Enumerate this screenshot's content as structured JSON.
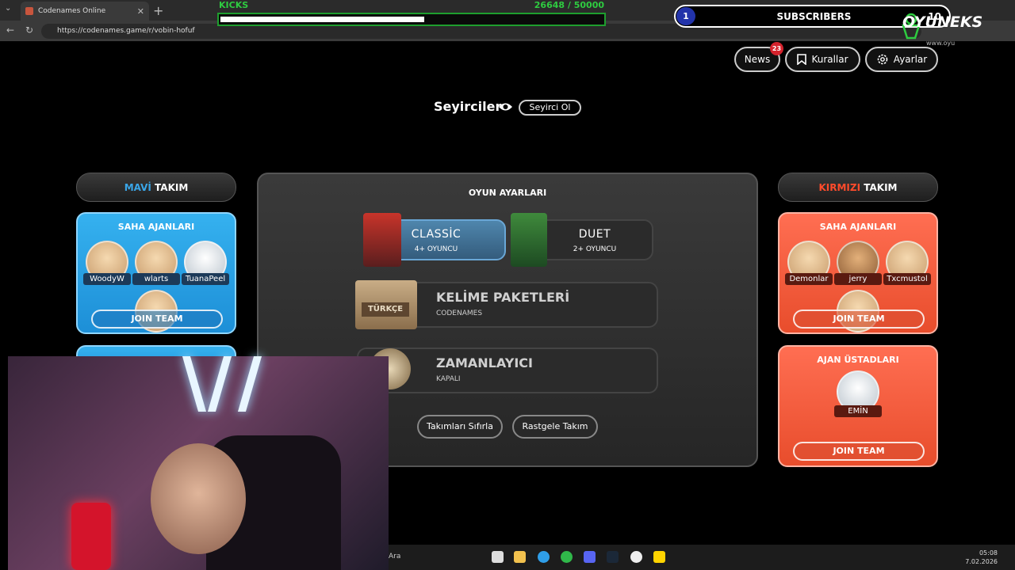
{
  "browser": {
    "tab_title": "Codenames Online",
    "tab_close": "✕",
    "new_tab": "+",
    "url": "https://codenames.game/r/vobin-hofuf"
  },
  "overlay": {
    "kicks_label": "KICKS",
    "kicks_value": "26648 / 50000",
    "kicks_progress": 0.533,
    "subscribers_rank": "1",
    "subscribers_label": "SUBSCRIBERS",
    "subscribers_goal": "10",
    "brand": "OYUNEKS",
    "brand_sub": "www.oyu"
  },
  "topnav": {
    "news_label": "News",
    "news_badge": "23",
    "rules_label": "Kurallar",
    "settings_label": "Ayarlar"
  },
  "spectators": {
    "label": "Seyirciler",
    "button": "Seyirci Ol"
  },
  "blue_team": {
    "header_word": "MAVİ",
    "header_rest": " TAKIM",
    "operatives_title": "SAHA AJANLARI",
    "players": [
      "WoodyW",
      "wlarts",
      "TuanaPeel"
    ],
    "join_label": "JOIN TEAM"
  },
  "red_team": {
    "header_word": "KIRMIZI",
    "header_rest": " TAKIM",
    "operatives_title": "SAHA AJANLARI",
    "players": [
      "Demonlar",
      "jerry",
      "Txcmustol"
    ],
    "join_label": "JOIN TEAM",
    "spymaster_title": "AJAN ÜSTADLARI",
    "spymaster": "EMİN",
    "spymaster_join": "JOIN TEAM"
  },
  "game_settings": {
    "title": "OYUN AYARLARI",
    "classic_name": "CLASSİC",
    "classic_sub": "4+ OYUNCU",
    "duet_name": "DUET",
    "duet_sub": "2+ OYUNCU",
    "word_pack_title": "KELİME PAKETLERİ",
    "word_pack_sub": "CODENAMES",
    "word_pack_box": "TÜRKÇE",
    "timer_title": "ZAMANLAYICI",
    "timer_sub": "KAPALI",
    "reset_teams": "Takımları Sıfırla",
    "random_teams": "Rastgele Takım"
  },
  "taskbar": {
    "search_text": "Ara",
    "time": "05:08",
    "date": "7.02.2026"
  },
  "colors": {
    "blue": "#2ea7ec",
    "red": "#f2583a",
    "kicks_green": "#2ecc40"
  }
}
